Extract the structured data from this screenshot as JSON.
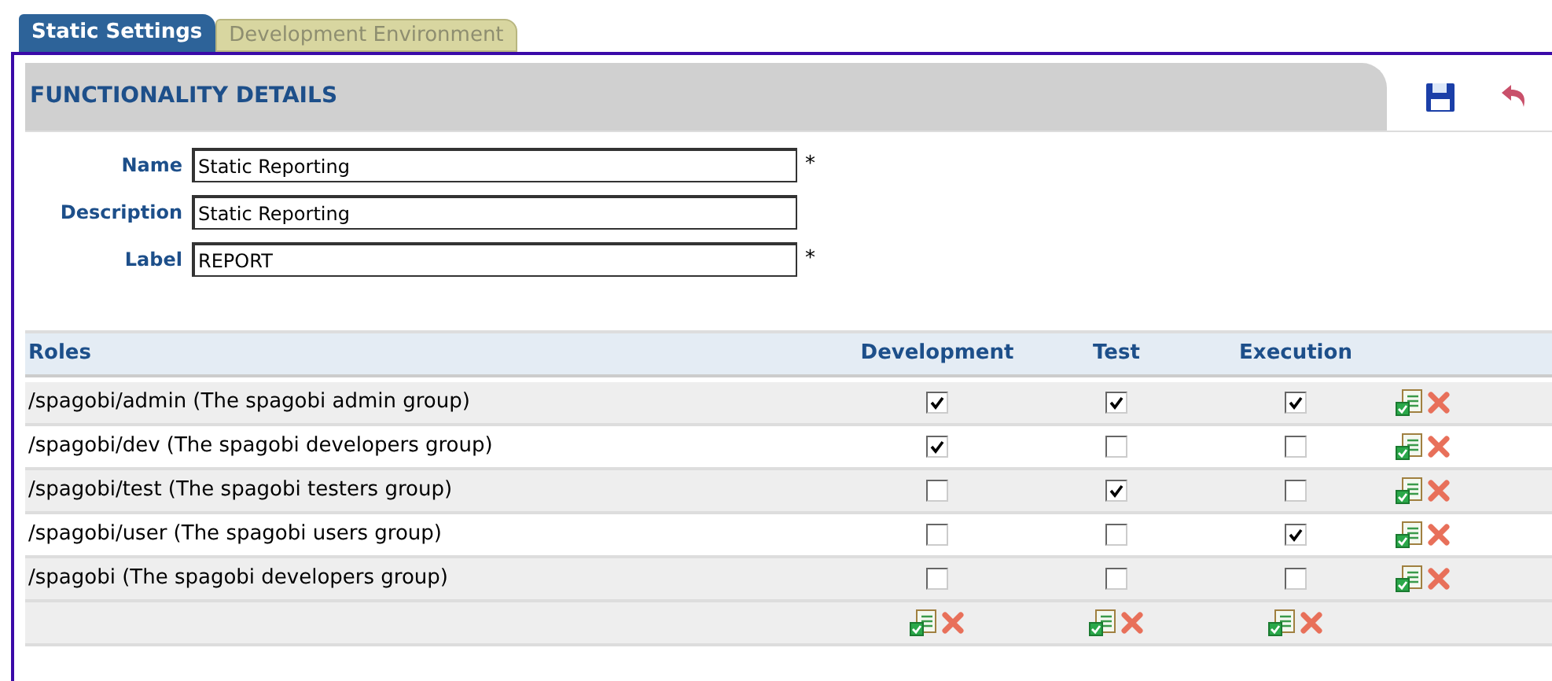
{
  "tabs": [
    {
      "label": "Static Settings",
      "selected": true
    },
    {
      "label": "Development Environment",
      "selected": false
    }
  ],
  "panel": {
    "title": "FUNCTIONALITY DETAILS"
  },
  "fields": [
    {
      "label": "Name",
      "value": "Static Reporting",
      "required_mark": "*"
    },
    {
      "label": "Description",
      "value": "Static Reporting"
    },
    {
      "label": "Label",
      "value": "REPORT",
      "required_mark": "*"
    }
  ],
  "table": {
    "columns": [
      "Roles",
      "Development",
      "Test",
      "Execution"
    ],
    "rows": [
      {
        "role": "/spagobi/admin (The spagobi admin group)",
        "checks": [
          true,
          true,
          true
        ]
      },
      {
        "role": "/spagobi/dev (The spagobi developers group)",
        "checks": [
          true,
          false,
          false
        ]
      },
      {
        "role": "/spagobi/test (The spagobi testers group)",
        "checks": [
          false,
          true,
          false
        ]
      },
      {
        "role": "/spagobi/user (The spagobi users group)",
        "checks": [
          false,
          false,
          true
        ]
      },
      {
        "role": "/spagobi (The spagobi developers group)",
        "checks": [
          false,
          false,
          false
        ]
      }
    ]
  }
}
